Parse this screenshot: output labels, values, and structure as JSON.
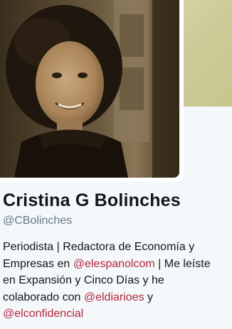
{
  "profile": {
    "name": "Cristina G Bolinches",
    "handle": "@CBolinches",
    "bio": {
      "line1": "Periodista | Redactora de Economía y",
      "line2_pre": "Empresas en ",
      "mention1": "@elespanolcom",
      "line2_post": " | Me leíste",
      "line3": "en Expansión y Cinco Días y he",
      "line4_pre": "colaborado con ",
      "mention2": "@eldiarioes",
      "line4_post": " y",
      "mention3": "@elconfidencial"
    }
  },
  "colors": {
    "link": "#b0263f",
    "name": "#14171a",
    "handle": "#657786",
    "page_background": "#f5f8fa"
  }
}
